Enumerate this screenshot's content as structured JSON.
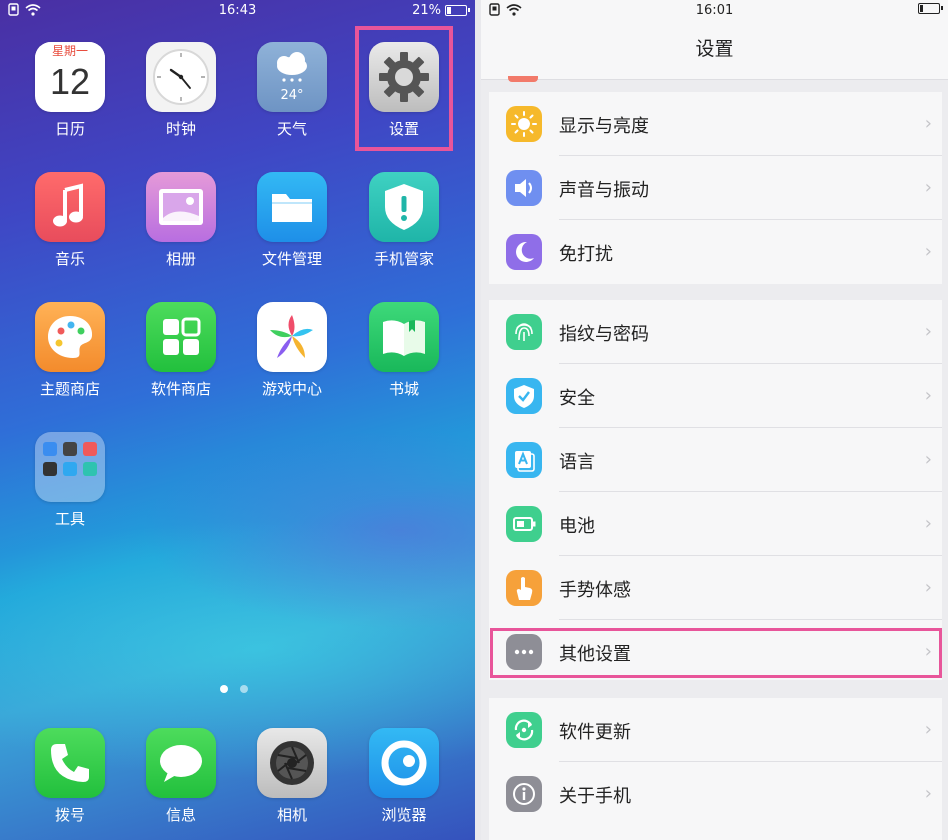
{
  "left_screen": {
    "status": {
      "time": "16:43",
      "battery": "21%",
      "battery_level": 0.21
    },
    "apps": [
      {
        "id": "calendar",
        "label": "日历",
        "weekday": "星期一",
        "day": "12"
      },
      {
        "id": "clock",
        "label": "时钟"
      },
      {
        "id": "weather",
        "label": "天气",
        "temp": "24°"
      },
      {
        "id": "settings",
        "label": "设置"
      },
      {
        "id": "music",
        "label": "音乐"
      },
      {
        "id": "album",
        "label": "相册"
      },
      {
        "id": "files",
        "label": "文件管理"
      },
      {
        "id": "guard",
        "label": "手机管家"
      },
      {
        "id": "theme",
        "label": "主题商店"
      },
      {
        "id": "store",
        "label": "软件商店"
      },
      {
        "id": "games",
        "label": "游戏中心"
      },
      {
        "id": "books",
        "label": "书城"
      },
      {
        "id": "tools",
        "label": "工具"
      }
    ],
    "dock": [
      {
        "id": "phone",
        "label": "拨号"
      },
      {
        "id": "messages",
        "label": "信息"
      },
      {
        "id": "camera",
        "label": "相机"
      },
      {
        "id": "browser",
        "label": "浏览器"
      }
    ],
    "page_indicator": {
      "count": 2,
      "active": 1
    }
  },
  "right_screen": {
    "status": {
      "time": "16:01"
    },
    "title": "设置",
    "items": [
      {
        "id": "display",
        "label": "显示与亮度",
        "icon": "sun-icon",
        "color": "#f6b92b"
      },
      {
        "id": "sound",
        "label": "声音与振动",
        "icon": "speaker-icon",
        "color": "#6f8ff0"
      },
      {
        "id": "dnd",
        "label": "免打扰",
        "icon": "moon-icon",
        "color": "#8f6ee8"
      },
      {
        "id": "fingerprint",
        "label": "指纹与密码",
        "icon": "fingerprint-icon",
        "color": "#3fcf8e"
      },
      {
        "id": "security",
        "label": "安全",
        "icon": "shield-check-icon",
        "color": "#38b6f0"
      },
      {
        "id": "language",
        "label": "语言",
        "icon": "language-icon",
        "color": "#38b6f0"
      },
      {
        "id": "battery",
        "label": "电池",
        "icon": "battery-icon",
        "color": "#3fcf8e"
      },
      {
        "id": "gesture",
        "label": "手势体感",
        "icon": "hand-icon",
        "color": "#f6a13a"
      },
      {
        "id": "other",
        "label": "其他设置",
        "icon": "more-dots-icon",
        "color": "#8e8e96"
      },
      {
        "id": "update",
        "label": "软件更新",
        "icon": "update-icon",
        "color": "#3fcf8e"
      },
      {
        "id": "about",
        "label": "关于手机",
        "icon": "info-icon",
        "color": "#8e8e96"
      }
    ],
    "chevron": "›"
  }
}
